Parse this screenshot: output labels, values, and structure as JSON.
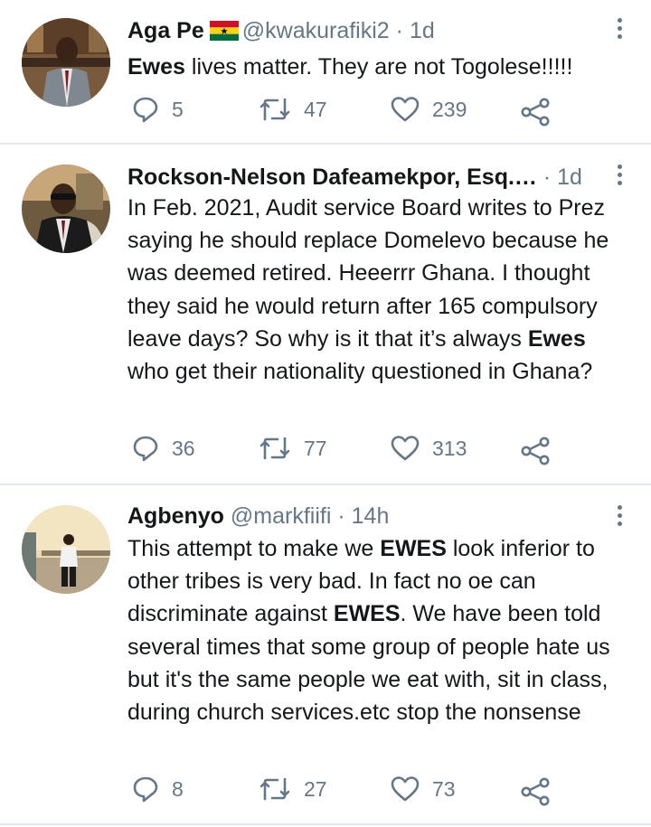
{
  "tweets": [
    {
      "name": "Aga Pe",
      "flag": "ghana-flag",
      "handle": "@kwakurafiki2",
      "dot": "·",
      "time": "1d",
      "text_parts": [
        {
          "bold": "Ewes"
        },
        {
          "plain": " lives matter. They are not Togolese!!!!!"
        }
      ],
      "replies": "5",
      "retweets": "47",
      "likes": "239"
    },
    {
      "name": "Rockson-Nelson Dafeamekpor, Esq.…",
      "handle": "",
      "dot": "·",
      "time": "1d",
      "text_parts": [
        {
          "plain": "In Feb. 2021, Audit service Board writes to Prez saying he should replace Domelevo because he was deemed retired. Heeerrr Ghana. I thought they said he would return after 165 compulsory leave days? So why is it that it’s always "
        },
        {
          "bold": "Ewes"
        },
        {
          "plain": " who get their nationality questioned in Ghana?"
        }
      ],
      "replies": "36",
      "retweets": "77",
      "likes": "313"
    },
    {
      "name": "Agbenyo",
      "handle": "@markfiifi",
      "dot": "·",
      "time": "14h",
      "text_parts": [
        {
          "plain": "This attempt to make we "
        },
        {
          "bold": "EWES"
        },
        {
          "plain": " look inferior to other tribes is very bad. In fact no oe can discriminate against  "
        },
        {
          "bold": "EWES"
        },
        {
          "plain": ". We have been told several times that some group of people hate us but it's the same people we eat with, sit in class, during church services.etc stop the nonsense"
        }
      ],
      "replies": "8",
      "retweets": "27",
      "likes": "73"
    }
  ],
  "icons": {
    "reply": "reply-icon",
    "retweet": "retweet-icon",
    "like": "like-icon",
    "share": "share-icon",
    "menu": "more-options-icon"
  },
  "colors": {
    "text": "#14171a",
    "muted": "#657786",
    "divider": "#e1e8ed"
  }
}
